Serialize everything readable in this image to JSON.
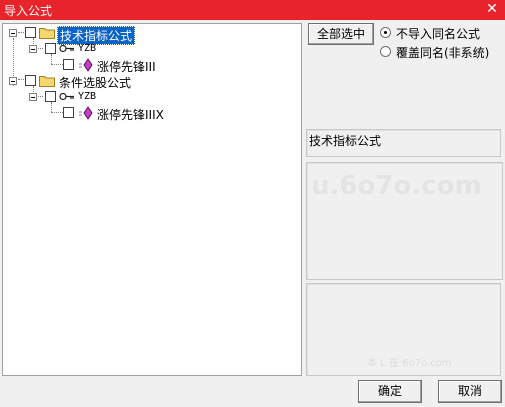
{
  "window": {
    "title": "导入公式",
    "close_symbol": "✕"
  },
  "tree": {
    "nodes": [
      {
        "label": "技术指标公式",
        "children": [
          {
            "label": "YZB",
            "children": [
              {
                "label": "涨停先锋III"
              }
            ]
          }
        ]
      },
      {
        "label": "条件选股公式",
        "children": [
          {
            "label": "YZB",
            "children": [
              {
                "label": "涨停先锋IIIX"
              }
            ]
          }
        ]
      }
    ]
  },
  "options": {
    "select_all_label": "全部选中",
    "radio_skip_label": "不导入同名公式",
    "radio_overwrite_label": "覆盖同名(非系统)",
    "selected": "skip"
  },
  "info": {
    "category": "技术指标公式"
  },
  "watermark": {
    "text": "u.6o7o.com",
    "small": "本 L 在 6o7o.com"
  },
  "footer": {
    "ok_label": "确定",
    "cancel_label": "取消"
  },
  "colors": {
    "titlebar": "#e8232b",
    "selection": "#0a64c8",
    "folder": "#f5d76e",
    "gem": "#c03ec8"
  }
}
